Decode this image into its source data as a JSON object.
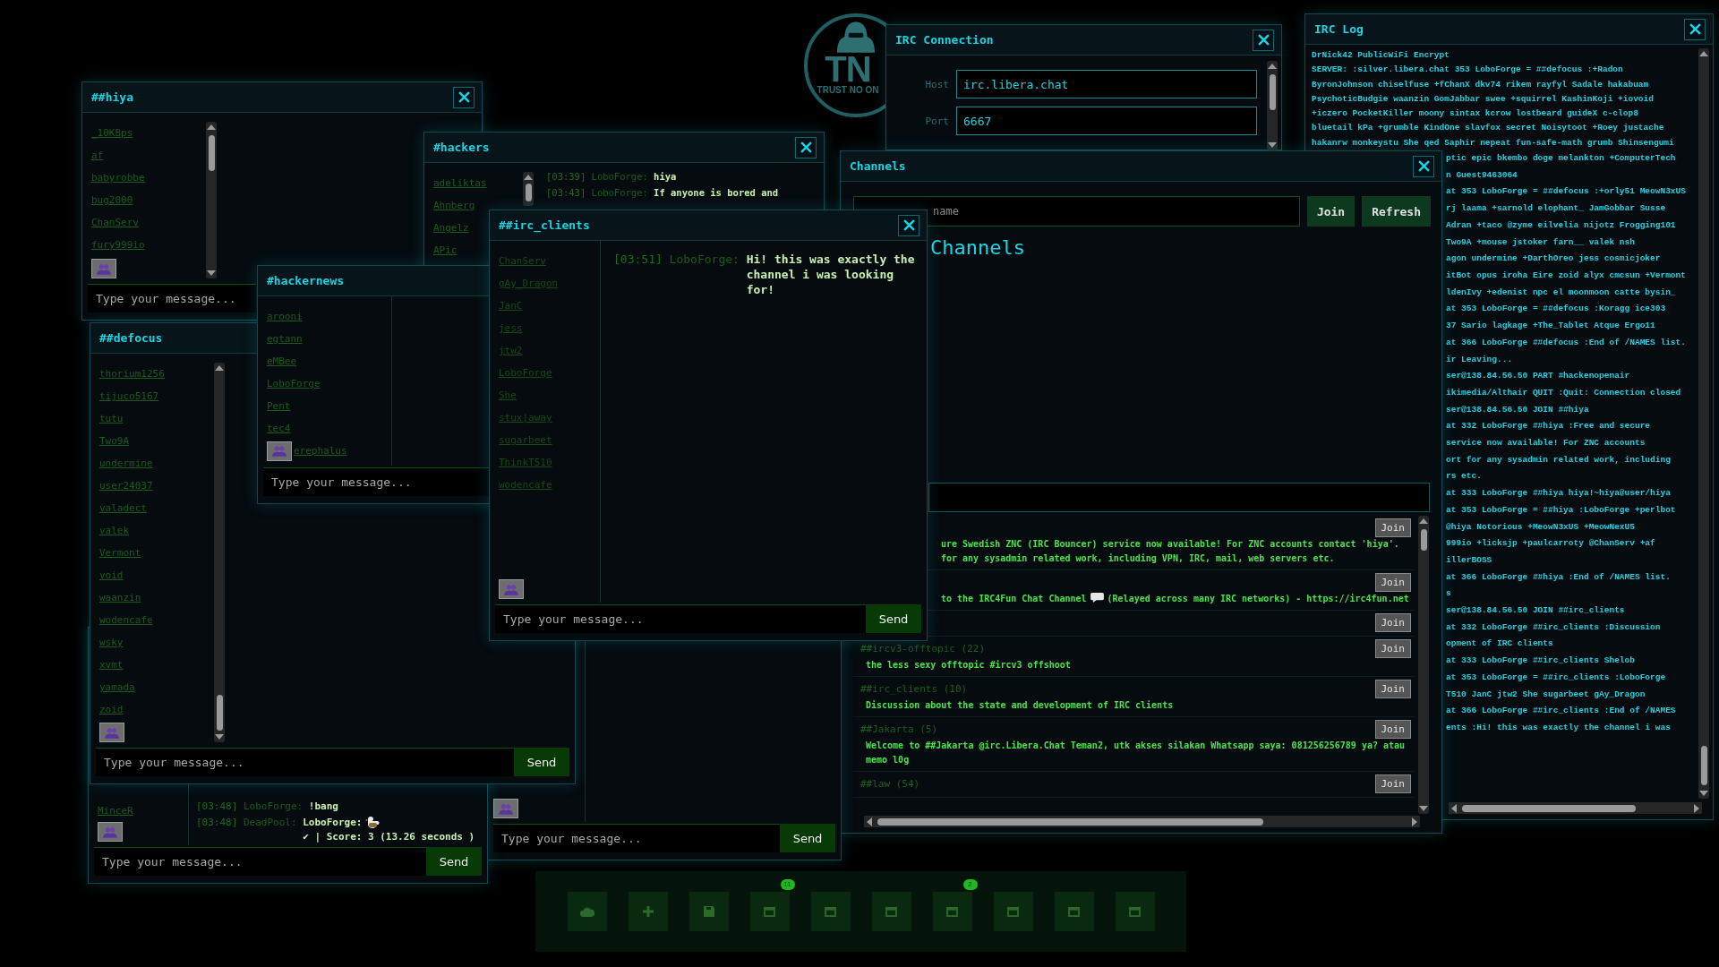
{
  "logo": {
    "title": "TN",
    "tagline": "TRUST NO ON"
  },
  "windows": [
    {
      "kind": "log",
      "title": "IRC Log",
      "closable": true,
      "lines": [
        "DrNick42 PublicWiFi Encrypt",
        "SERVER: :silver.libera.chat 353 LoboForge = ##defocus :+Radon",
        "ByronJohnson chiselfuse +fChanX dkv74 rikem rayfyl Sadale hakabuam",
        "PsychoticBudgie waanzin GomJabbar swee +squirrel KashinKoji +iovoid",
        "+iczero PocketKiller moony sintax kcrow lostbeard guideX c-clop8",
        "bluetail kPa +grumble KindOne slavfox secret Noisytoot +Roey justache",
        "hakanrw monkeystu She qed Saphir nepeat fun-safe-math grumb Shinsengumi"
      ],
      "tail_lines": [
        "ptic epic bkembo doge melankton +ComputerTech",
        "n Guest9463064",
        "at 353 LoboForge = ##defocus :+orly51 MeowN3xUS",
        "rj laama +sarnold elophant_ JamGobbar Susse",
        "Adran +taco @zyme eilvelia nijotz Frogging101",
        "Two9A +mouse jstoker farn__ valek nsh",
        "agon undermine +DarthOreo jess cosmicjoker",
        "itBot opus iroha Eire zoid alyx cmcsun +Vermont",
        "ldenIvy +edenist npc el moonmoon catte bysin_",
        "at 353 LoboForge = ##defocus :Koragg ice303",
        "37 Sario lagkage +The_Tablet Atque Ergo11",
        "at 366 LoboForge ##defocus :End of /NAMES list.",
        "ir Leaving...",
        "ser@138.84.56.50 PART #hackenopenair",
        "ikimedia/Althair QUIT :Quit: Connection closed",
        "ser@138.84.56.50 JOIN ##hiya",
        "at 332 LoboForge ##hiya :Free and secure",
        "service now available! For ZNC accounts",
        "ort for any sysadmin related work, including",
        "rs etc.",
        "at 333 LoboForge ##hiya hiya!~hiya@user/hiya",
        "at 353 LoboForge = ##hiya :LoboForge +perlbot",
        "@hiya Notorious +MeowN3xUS +MeowNexU5",
        "999io +licksjp +paulcarroty @ChanServ +af",
        "illerBOSS",
        "at 366 LoboForge ##hiya :End of /NAMES list.",
        "s",
        "ser@138.84.56.50 JOIN ##irc_clients",
        "at 332 LoboForge ##irc_clients :Discussion",
        "opment of IRC clients",
        "at 333 LoboForge ##irc_clients Shelob",
        "at 353 LoboForge = ##irc_clients :LoboForge",
        "T510 JanC jtw2 She sugarbeet gAy_Dragon",
        "at 366 LoboForge ##irc_clients :End of /NAMES",
        "ents :Hi! this was exactly the channel i was"
      ]
    },
    {
      "kind": "connection",
      "title": "IRC Connection",
      "closable": true,
      "fields": [
        {
          "label": "Host",
          "value": "irc.libera.chat"
        },
        {
          "label": "Port",
          "value": "6667"
        }
      ]
    },
    {
      "kind": "channels",
      "title": "Channels",
      "closable": true,
      "search": {
        "placeholder": "name"
      },
      "buttons": [
        "Join",
        "Refresh"
      ],
      "heading": "Channels",
      "list": [
        {
          "join_label": "Join",
          "topic_lines": [
            [
              {
                "kind": "text",
                "text": "ure Swedish ZNC (IRC Bouncer) service now available! For ZNC accounts contact 'hiya'."
              }
            ],
            [
              {
                "kind": "text",
                "text": "for any sysadmin related work, including VPN, IRC, mail, web servers etc."
              }
            ]
          ]
        },
        {
          "join_label": "Join",
          "topic_lines": [
            [
              {
                "kind": "text",
                "text": "to the IRC4Fun Chat Channel"
              },
              {
                "kind": "icon"
              },
              {
                "kind": "text",
                "text": "(Relayed across many IRC networks) - https://irc4fun.net"
              }
            ]
          ]
        },
        {
          "join_label": "Join"
        },
        {
          "name": "##ircv3-offtopic (22)",
          "join_label": "Join",
          "topic_lines": [
            [
              {
                "kind": "text",
                "text": "the less sexy offtopic #ircv3 offshoot"
              }
            ]
          ]
        },
        {
          "name": "##irc_clients (10)",
          "join_label": "Join",
          "topic_lines": [
            [
              {
                "kind": "text",
                "text": "Discussion about the state and development of IRC clients"
              }
            ]
          ]
        },
        {
          "name": "##Jakarta (5)",
          "join_label": "Join",
          "topic_lines": [
            [
              {
                "kind": "text",
                "text": "Welcome to ##Jakarta @irc.Libera.Chat Teman2, utk akses silakan Whatsapp saya: 081256256789 ya? atau memo l0g"
              }
            ]
          ]
        },
        {
          "name": "##law (54)",
          "join_label": "Join"
        }
      ]
    },
    {
      "kind": "chat",
      "title": "##hiya",
      "closable": true,
      "nicks": [
        "_10KBps",
        "af",
        "babyrobbe",
        "bug2000",
        "ChanServ",
        "fury999io"
      ],
      "input": {
        "placeholder": "Type your message..."
      }
    },
    {
      "kind": "chat",
      "title": "#hackers",
      "closable": true,
      "nicks": [
        "adeliktas",
        "Ahnberg",
        "Angelz",
        "APic"
      ],
      "messages": [
        {
          "time": "[03:39]",
          "nick": "LoboForge:",
          "parts": [
            {
              "kind": "text",
              "text": "hiya"
            }
          ]
        },
        {
          "time": "[03:43]",
          "nick": "LoboForge:",
          "parts": [
            {
              "kind": "text",
              "text": "If anyone is bored and"
            }
          ]
        }
      ]
    },
    {
      "kind": "chat",
      "input": {
        "placeholder": "Type your message..."
      },
      "send": "Send"
    },
    {
      "kind": "chat",
      "title": "##defocus",
      "closable": false,
      "nicks": [
        "thorium1256",
        "tijuco5167",
        "tutu",
        "Two9A",
        "undermine",
        "user24037",
        "valadect",
        "valek",
        "Vermont",
        "void",
        "waanzin",
        "wodencafe",
        "wsky",
        "xvmt",
        "yamada",
        "zoid"
      ],
      "input": {
        "placeholder": "Type your message..."
      },
      "send": "Send"
    },
    {
      "kind": "chat",
      "nicks": [
        "MinceR"
      ],
      "messages": [
        {
          "time": "[03:48]",
          "nick": "LoboForge:",
          "parts": [
            {
              "kind": "text",
              "text": "!bang"
            }
          ]
        },
        {
          "time": "[03:48]",
          "nick": "DeadPool:",
          "parts": [
            {
              "kind": "text",
              "text": "LoboForge:"
            },
            {
              "kind": "icon"
            },
            {
              "kind": "text",
              "text": "✔ | Score: 3 (13.26 seconds )"
            }
          ]
        }
      ],
      "input": {
        "placeholder": "Type your message..."
      },
      "send": "Send"
    },
    {
      "kind": "chat",
      "title": "#hackernews",
      "closable": false,
      "nicks": [
        "arooni",
        "egtann",
        "eMBee",
        "LoboForge",
        "Pent",
        "tec4"
      ],
      "partial_nick": "erephalus",
      "input": {
        "placeholder": "Type your message..."
      }
    },
    {
      "kind": "chat",
      "title": "##irc_clients",
      "closable": true,
      "nicks": [
        "ChanServ",
        "gAy_Dragon",
        "JanC",
        "jess",
        "jtw2",
        "LoboForge",
        "She",
        "stux|away",
        "sugarbeet",
        "ThinkT510",
        "wodencafe"
      ],
      "messages": [
        {
          "time": "[03:51]",
          "nick": "LoboForge:",
          "parts": [
            {
              "kind": "text",
              "text": "Hi! this was exactly the channel i was looking for!"
            }
          ]
        }
      ],
      "input": {
        "placeholder": "Type your message..."
      },
      "send": "Send"
    }
  ],
  "dock": {
    "items": [
      {
        "kind": "cloud"
      },
      {
        "kind": "plus"
      },
      {
        "kind": "disk"
      },
      {
        "kind": "window",
        "badge": "11"
      },
      {
        "kind": "window"
      },
      {
        "kind": "window"
      },
      {
        "kind": "window",
        "badge": "2"
      },
      {
        "kind": "window"
      },
      {
        "kind": "window"
      },
      {
        "kind": "window"
      }
    ]
  }
}
